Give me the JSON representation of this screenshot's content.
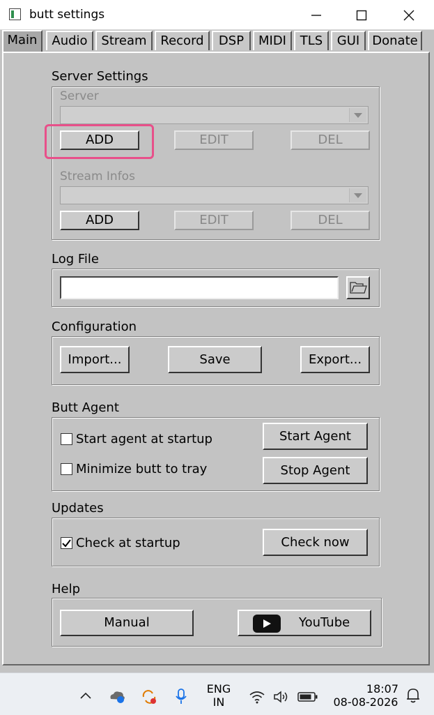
{
  "window": {
    "title": "butt settings"
  },
  "tabs": [
    "Main",
    "Audio",
    "Stream",
    "Record",
    "DSP",
    "MIDI",
    "TLS",
    "GUI",
    "Donate"
  ],
  "server_settings": {
    "heading": "Server Settings",
    "server_label": "Server",
    "server_value": "",
    "stream_infos_label": "Stream Infos",
    "stream_infos_value": "",
    "add_label": "ADD",
    "edit_label": "EDIT",
    "del_label": "DEL"
  },
  "log_file": {
    "heading": "Log File",
    "value": ""
  },
  "configuration": {
    "heading": "Configuration",
    "import_label": "Import...",
    "save_label": "Save",
    "export_label": "Export..."
  },
  "butt_agent": {
    "heading": "Butt Agent",
    "start_at_startup_label": "Start agent at startup",
    "start_at_startup_checked": false,
    "minimize_to_tray_label": "Minimize butt to tray",
    "minimize_to_tray_checked": false,
    "start_agent_label": "Start Agent",
    "stop_agent_label": "Stop Agent"
  },
  "updates": {
    "heading": "Updates",
    "check_at_startup_label": "Check at startup",
    "check_at_startup_checked": true,
    "check_now_label": "Check now"
  },
  "help": {
    "heading": "Help",
    "manual_label": "Manual",
    "youtube_label": "YouTube"
  },
  "taskbar": {
    "language_line1": "ENG",
    "language_line2": "IN",
    "time": "18:07",
    "date": "08-08-2026"
  },
  "colors": {
    "highlight": "#e8508a",
    "panel": "#c3c3c3",
    "youtube_icon": "#111111"
  }
}
